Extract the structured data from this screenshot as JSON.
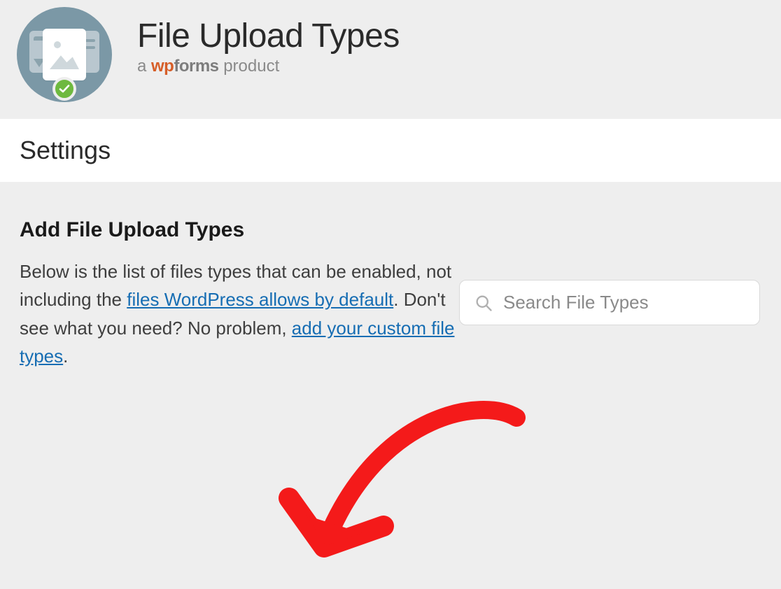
{
  "header": {
    "title": "File Upload Types",
    "subline_prefix": "a ",
    "brand_wp": "wp",
    "brand_forms": "forms",
    "subline_suffix": " product"
  },
  "settings": {
    "heading": "Settings"
  },
  "section": {
    "title": "Add File Upload Types",
    "desc_part1": "Below is the list of files types that can be enabled, not including the ",
    "link1": "files WordPress allows by default",
    "desc_part2": ". Don't see what you need? No problem, ",
    "link2": "add your custom file types",
    "desc_part3": "."
  },
  "search": {
    "placeholder": "Search File Types"
  }
}
